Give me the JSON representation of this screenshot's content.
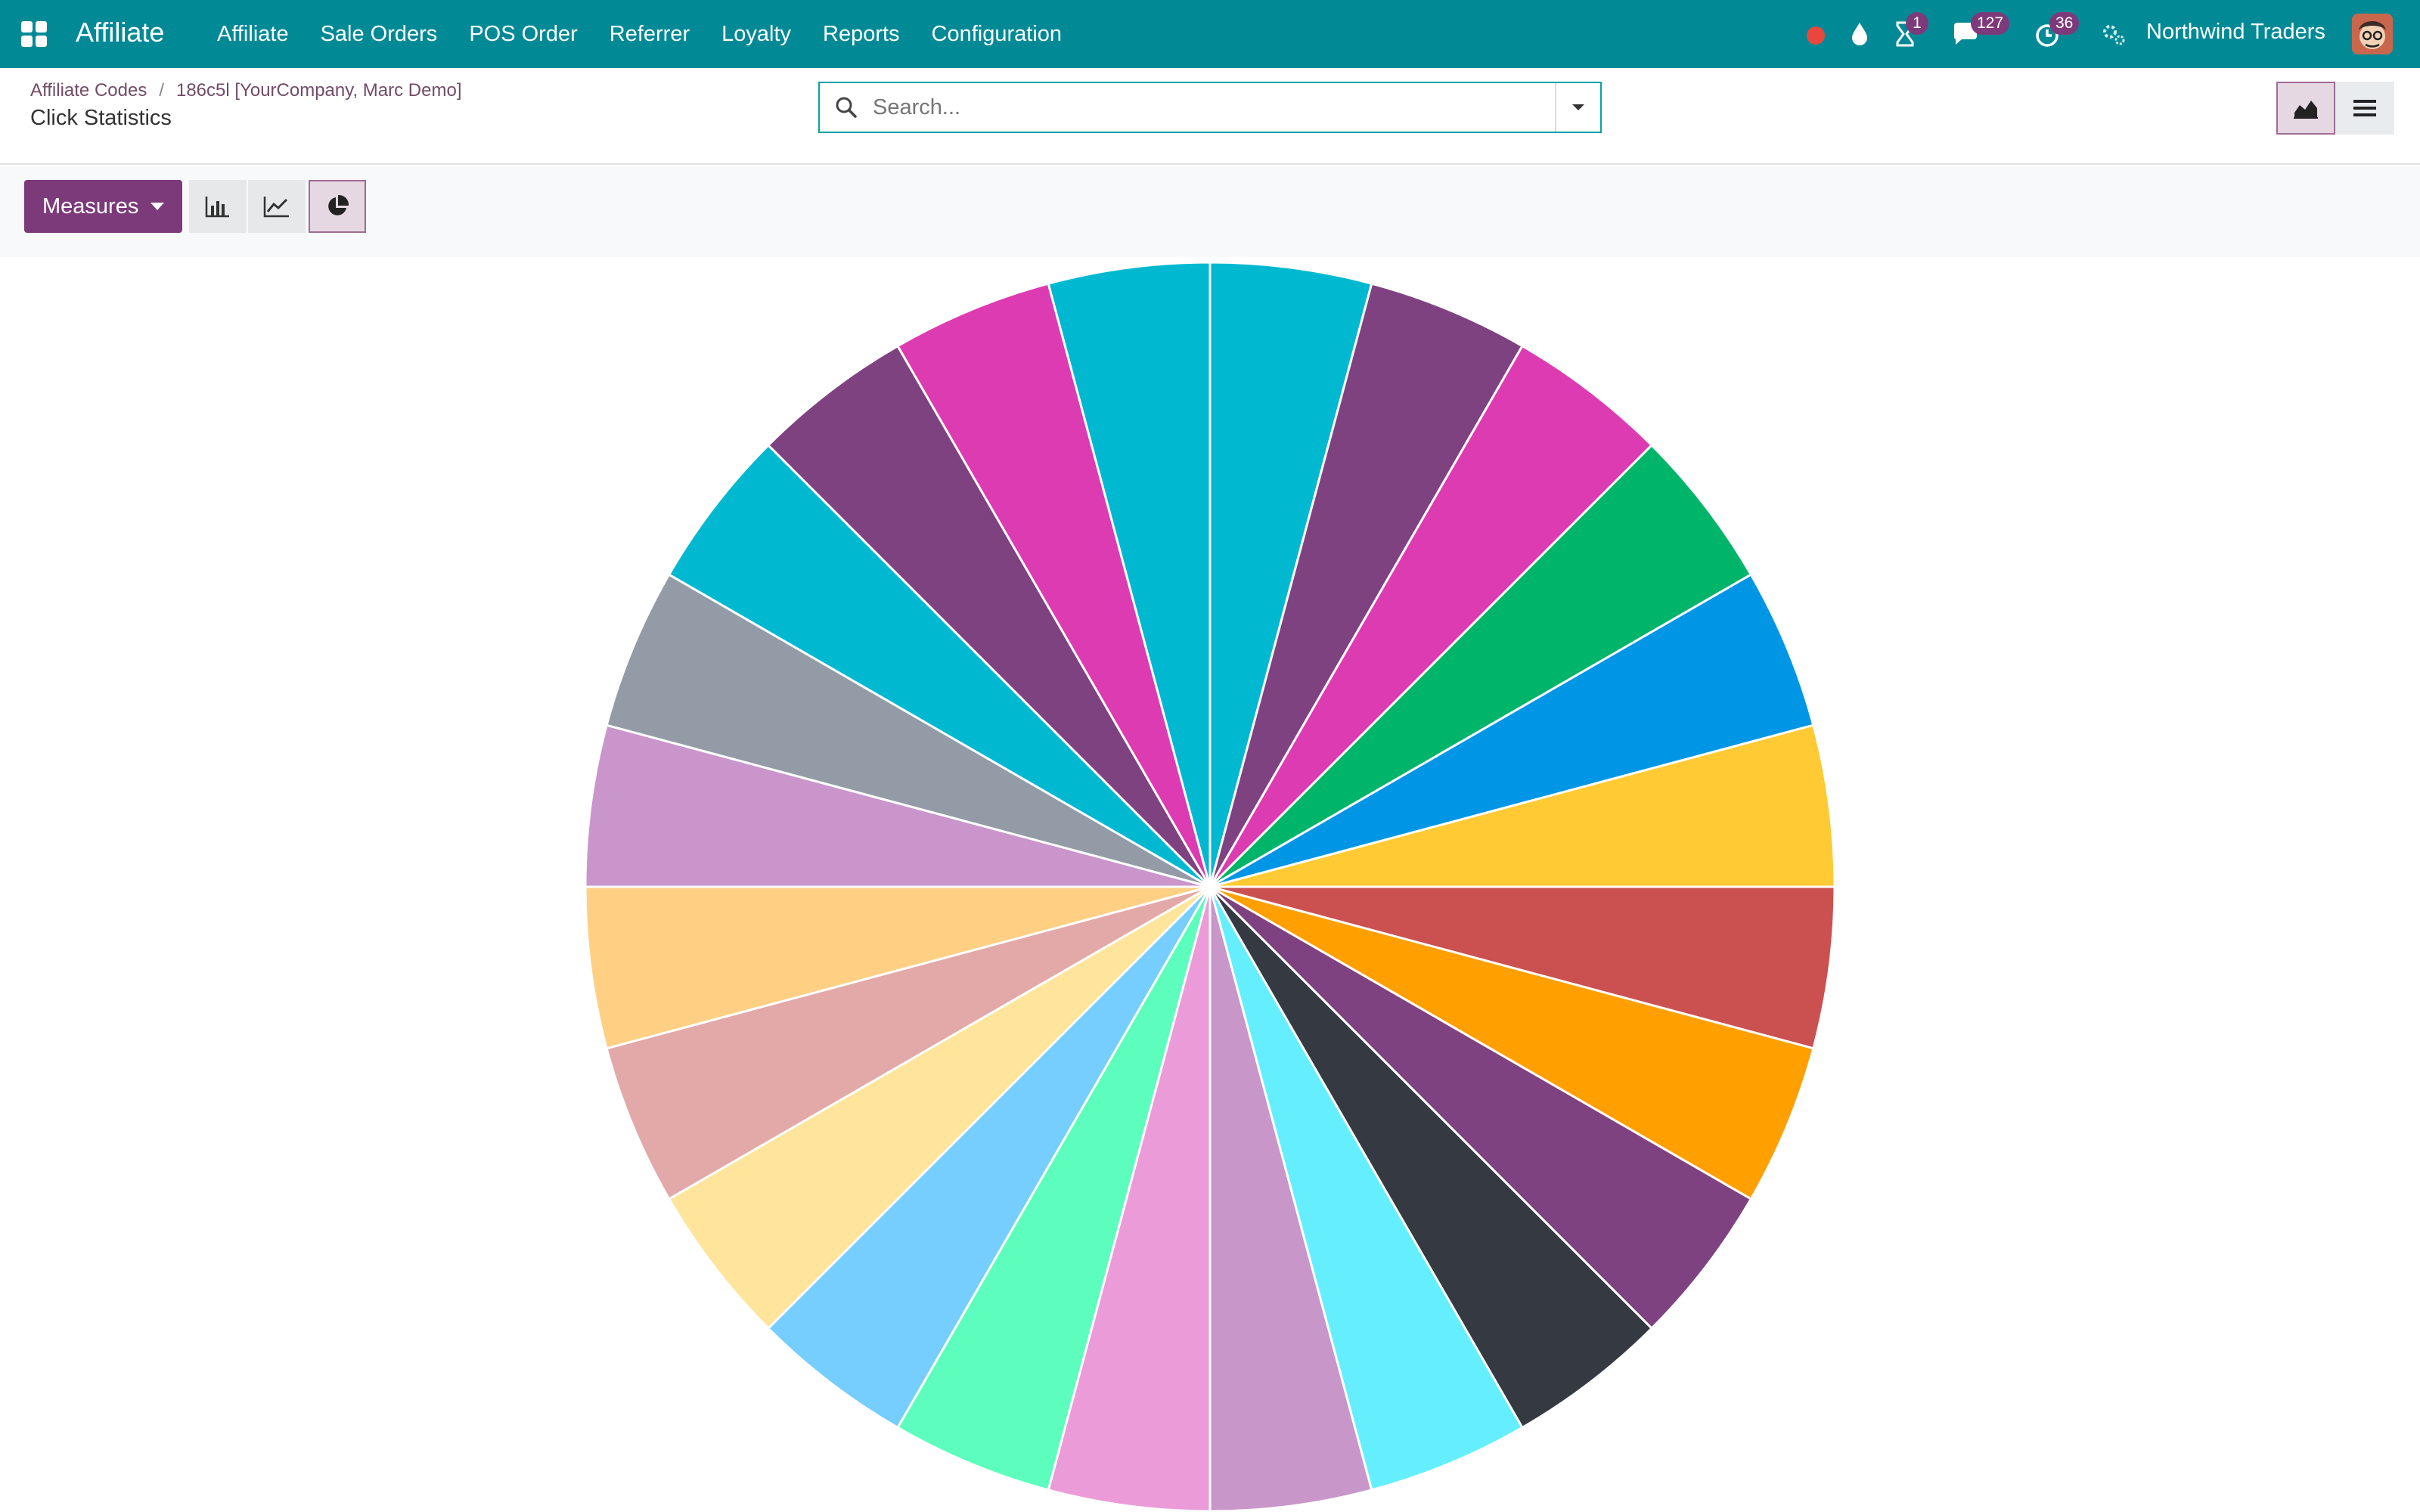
{
  "navbar": {
    "brand": "Affiliate",
    "menu": [
      "Affiliate",
      "Sale Orders",
      "POS Order",
      "Referrer",
      "Loyalty",
      "Reports",
      "Configuration"
    ],
    "badges": {
      "activities": "1",
      "messages": "127",
      "clock": "36"
    },
    "company": "Northwind Traders",
    "icons": [
      "apps-grid-icon",
      "record-dot-icon",
      "droplet-icon",
      "hourglass-icon",
      "chat-icon",
      "clock-icon",
      "gears-icon"
    ]
  },
  "breadcrumb": {
    "parent": "Affiliate Codes",
    "record": "186c5l [YourCompany, Marc Demo]"
  },
  "page": {
    "title": "Click Statistics"
  },
  "search": {
    "placeholder": "Search..."
  },
  "toolbar": {
    "measures_label": "Measures"
  },
  "colors": {
    "navbar": "#018a96",
    "accent": "#7c3a7a"
  },
  "chart_data": {
    "type": "pie",
    "values": [
      1,
      1,
      1,
      1,
      1,
      1,
      1,
      1,
      1,
      1,
      1,
      1,
      1,
      1,
      1,
      1,
      1,
      1,
      1,
      1,
      1,
      1,
      1,
      1
    ],
    "colors": [
      "#00b9d1",
      "#7f4281",
      "#dd3bb1",
      "#00b46a",
      "#0096e5",
      "#ffca34",
      "#cb5150",
      "#ffa000",
      "#7f4281",
      "#353a42",
      "#65effe",
      "#c896c9",
      "#eb9cd8",
      "#5dfebd",
      "#75cefd",
      "#ffe59c",
      "#e3a8a8",
      "#ffd084",
      "#c995cb",
      "#939ca6",
      "#00b9d1",
      "#7f4281",
      "#dd3bb1"
    ],
    "title": "",
    "legend": "none"
  }
}
